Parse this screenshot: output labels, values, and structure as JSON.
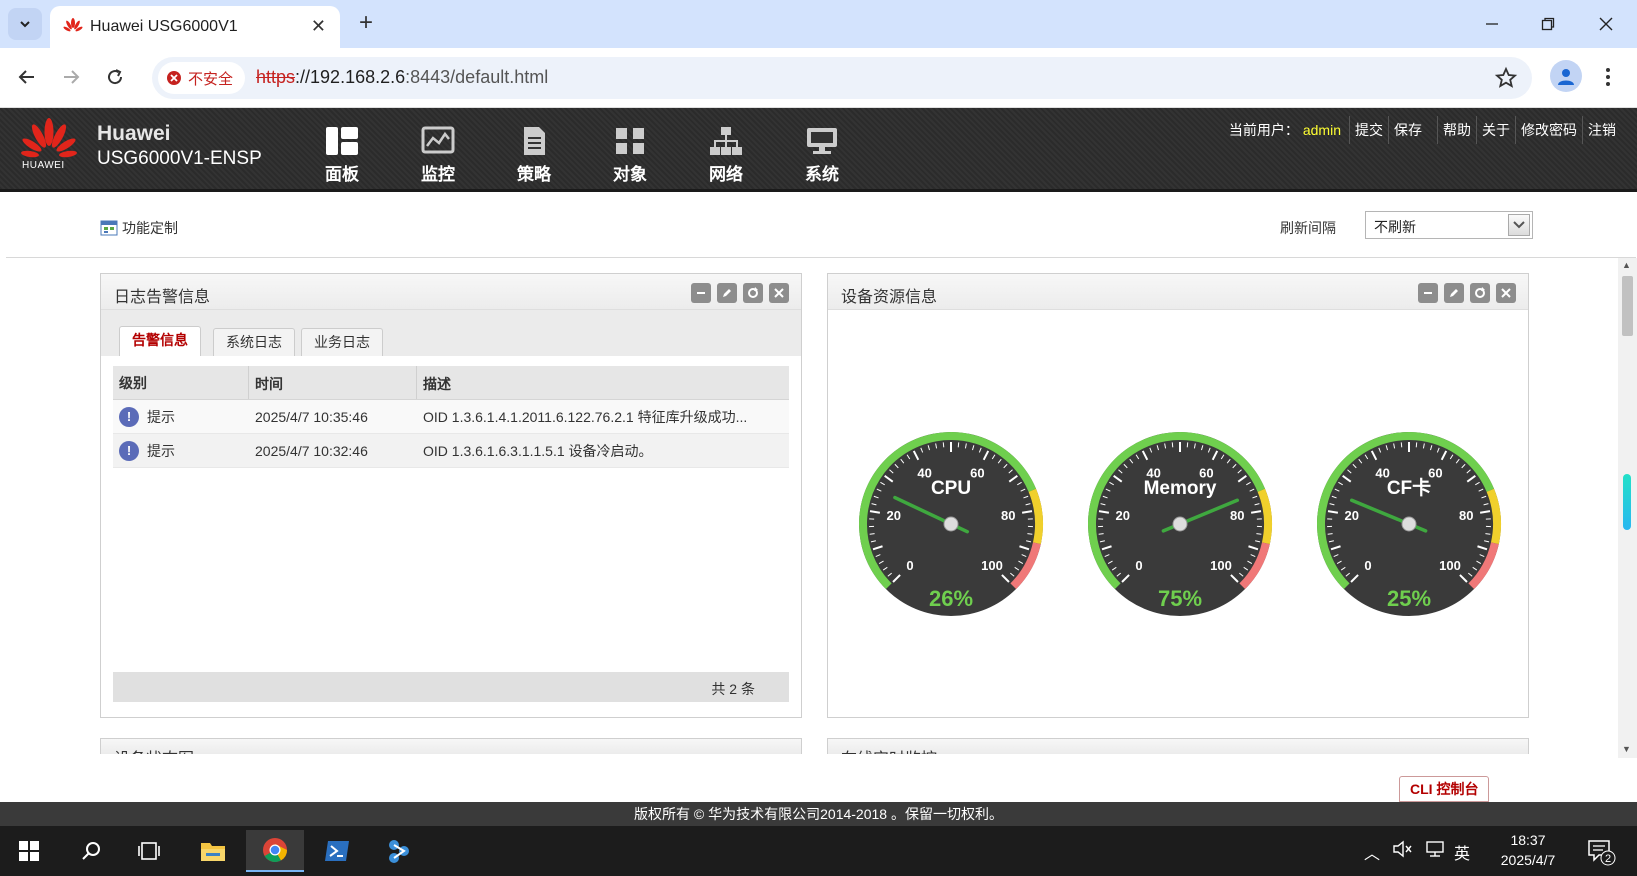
{
  "browser": {
    "tab_title": "Huawei USG6000V1",
    "security_label": "不安全",
    "url_scheme": "https",
    "url_host": "://192.168.2.6",
    "url_port_path": ":8443/default.html"
  },
  "header": {
    "brand": "Huawei",
    "model": "USG6000V1-ENSP",
    "logo_text": "HUAWEI",
    "nav": [
      {
        "label": "面板",
        "icon": "dashboard-icon"
      },
      {
        "label": "监控",
        "icon": "monitor-icon"
      },
      {
        "label": "策略",
        "icon": "policy-icon"
      },
      {
        "label": "对象",
        "icon": "object-icon"
      },
      {
        "label": "网络",
        "icon": "network-icon"
      },
      {
        "label": "系统",
        "icon": "system-icon"
      }
    ],
    "user_label": "当前用户：",
    "user_name": "admin",
    "links": [
      "提交",
      "保存",
      "帮助",
      "关于",
      "修改密码",
      "注销"
    ]
  },
  "subbar": {
    "customize": "功能定制",
    "refresh_label": "刷新间隔",
    "refresh_value": "不刷新"
  },
  "log_panel": {
    "title": "日志告警信息",
    "tabs": [
      "告警信息",
      "系统日志",
      "业务日志"
    ],
    "columns": [
      "级别",
      "时间",
      "描述"
    ],
    "rows": [
      {
        "level": "提示",
        "time": "2025/4/7 10:35:46",
        "desc": "OID 1.3.6.1.4.1.2011.6.122.76.2.1 特征库升级成功..."
      },
      {
        "level": "提示",
        "time": "2025/4/7 10:32:46",
        "desc": "OID 1.3.6.1.6.3.1.1.5.1 设备冷启动。"
      }
    ],
    "total": "共 2 条"
  },
  "resource_panel": {
    "title": "设备资源信息",
    "gauges": [
      {
        "label": "CPU",
        "value": 26,
        "display": "26%"
      },
      {
        "label": "Memory",
        "value": 75,
        "display": "75%"
      },
      {
        "label": "CF卡",
        "value": 25,
        "display": "25%"
      }
    ],
    "scale_labels": [
      "0",
      "20",
      "40",
      "60",
      "80",
      "100"
    ]
  },
  "peek_panels": [
    "设备状态图",
    "在线实时监控"
  ],
  "footer": {
    "copyright": "版权所有 © 华为技术有限公司2014-2018 。保留一切权利。",
    "cli_button": "CLI 控制台"
  },
  "taskbar": {
    "ime": "英",
    "time": "18:37",
    "date": "2025/4/7",
    "notif_count": "2"
  },
  "colors": {
    "accent_red": "#b30000",
    "gauge_green": "#6fcf4e",
    "gauge_yellow": "#f0d02c",
    "gauge_red": "#f07878",
    "admin_yellow": "#ffff33"
  }
}
